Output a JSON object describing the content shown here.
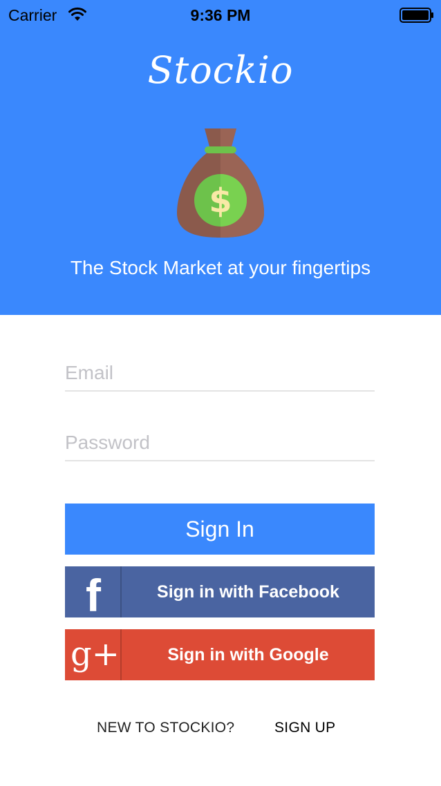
{
  "status_bar": {
    "carrier": "Carrier",
    "time": "9:36 PM",
    "wifi_icon": "wifi-icon",
    "battery_icon": "battery-icon"
  },
  "header": {
    "logo_text": "Stockio",
    "illustration_icon": "money-bag-icon",
    "tagline": "The Stock Market at your fingertips",
    "background_color": "#3a88fd"
  },
  "form": {
    "email_placeholder": "Email",
    "email_value": "",
    "password_placeholder": "Password",
    "password_value": ""
  },
  "buttons": {
    "sign_in": "Sign In",
    "facebook_glyph": "f",
    "facebook": "Sign in with Facebook",
    "google_glyph": "g+",
    "google": "Sign in with Google",
    "sign_in_color": "#3a88fd",
    "facebook_color": "#4a64a1",
    "google_color": "#dd4b36"
  },
  "footer": {
    "prompt": "NEW TO STOCKIO?",
    "sign_up": "SIGN UP"
  }
}
